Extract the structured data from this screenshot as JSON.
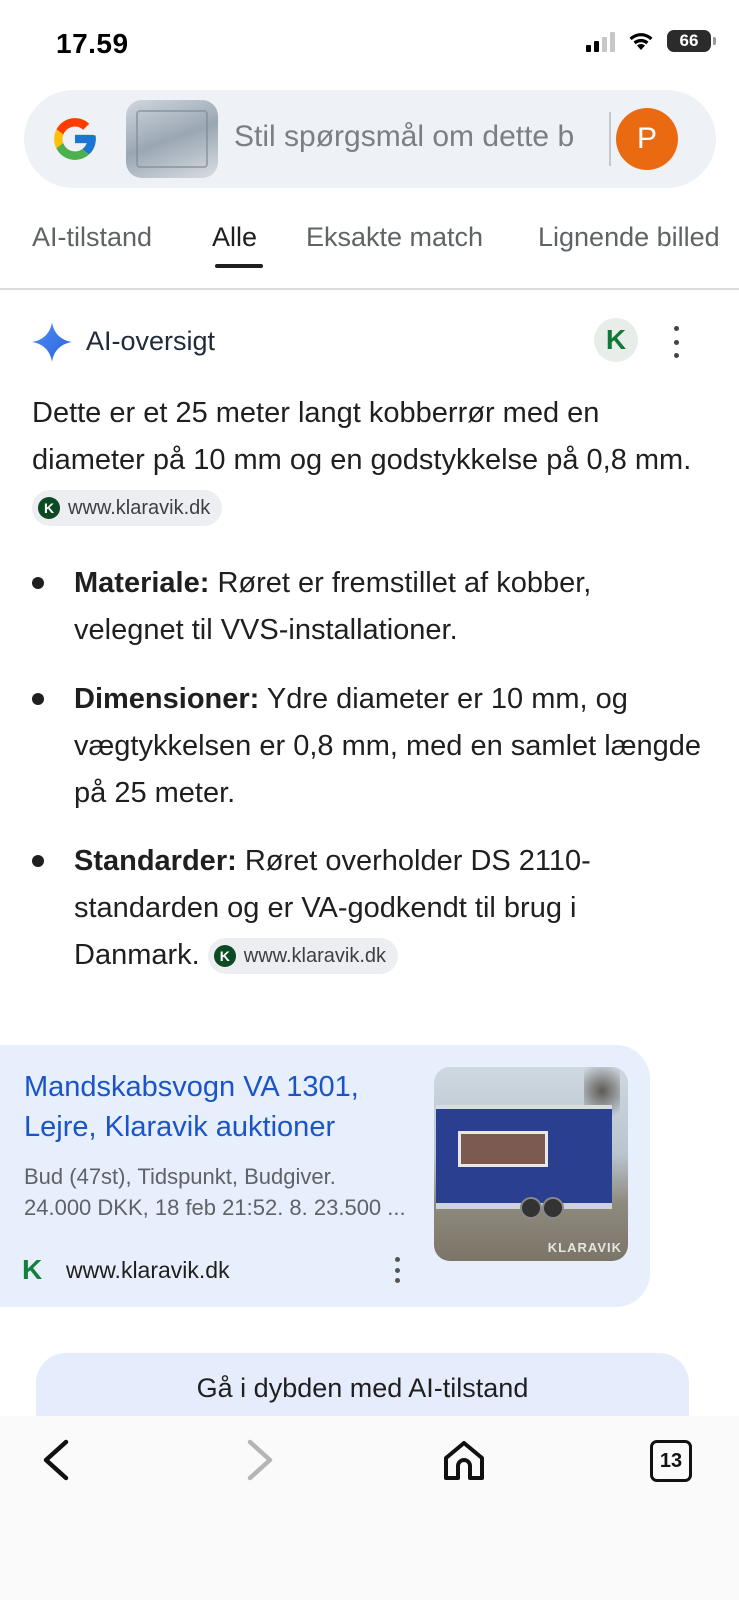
{
  "status_bar": {
    "time": "17.59",
    "battery": "66"
  },
  "search": {
    "placeholder": "Stil spørgsmål om dette b",
    "avatar_letter": "P"
  },
  "tabs": [
    {
      "label": "AI-tilstand",
      "active": false
    },
    {
      "label": "Alle",
      "active": true
    },
    {
      "label": "Eksakte match",
      "active": false
    },
    {
      "label": "Lignende billed",
      "active": false
    }
  ],
  "ai_overview": {
    "title": "AI-oversigt",
    "badge_letter": "K",
    "intro": "Dette er et 25 meter langt kobberrør med en diameter på 10 mm og en godstykkelse på 0,8 mm.",
    "intro_source": "www.klaravik.dk",
    "bullets": [
      {
        "label": "Materiale:",
        "text": " Røret er fremstillet af kobber, velegnet til VVS-installationer."
      },
      {
        "label": "Dimensioner:",
        "text": " Ydre diameter er 10 mm, og vægtykkelsen er 0,8 mm, med en samlet længde på 25 meter."
      },
      {
        "label": "Standarder:",
        "text": " Røret overholder DS 2110-standarden og er VA-godkendt til brug i Danmark.",
        "source": "www.klaravik.dk"
      }
    ]
  },
  "result_card": {
    "title": "Mandskabsvogn VA 1301, Lejre, Klaravik auktioner",
    "snippet_line1": "Bud (47st), Tidspunkt, Budgiver.",
    "snippet_line2": "24.000 DKK, 18 feb 21:52. 8. 23.500 ...",
    "source_icon_letter": "K",
    "source": "www.klaravik.dk",
    "image_watermark": "KLARAVIK"
  },
  "deep_dive_button": "Gå i dybden med AI-tilstand",
  "bottom_nav": {
    "tab_count": "13"
  },
  "colors": {
    "accent_blue": "#1a55c8",
    "avatar_orange": "#ea6a12",
    "card_bg": "#e7eefc",
    "klaravik_green": "#14803c"
  }
}
